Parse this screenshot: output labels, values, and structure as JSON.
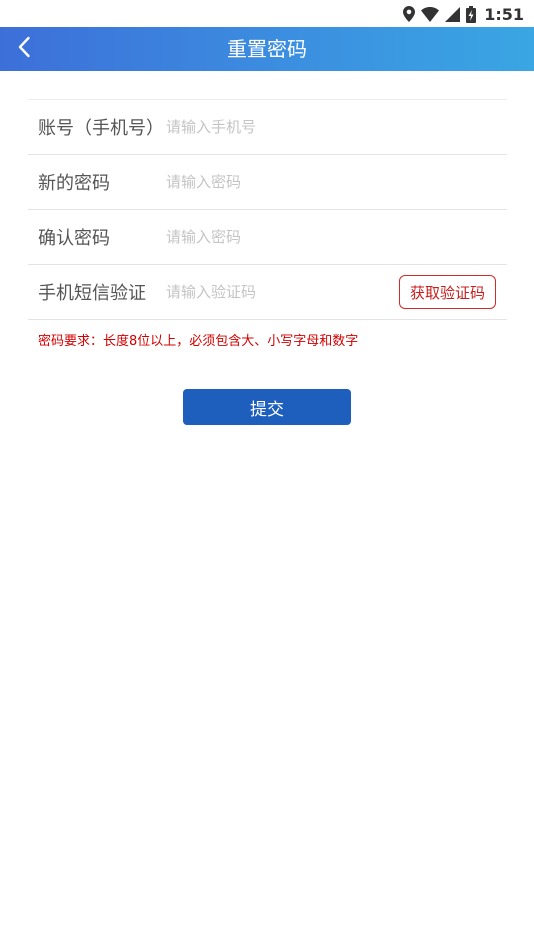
{
  "status_bar": {
    "time": "1:51",
    "icons": [
      "location-icon",
      "wifi-icon",
      "signal-icon",
      "battery-charging-icon"
    ]
  },
  "header": {
    "title": "重置密码",
    "back_icon": "chevron-left-icon"
  },
  "form": {
    "rows": [
      {
        "label": "账号（手机号）",
        "placeholder": "请输入手机号",
        "value": ""
      },
      {
        "label": "新的密码",
        "placeholder": "请输入密码",
        "value": ""
      },
      {
        "label": "确认密码",
        "placeholder": "请输入密码",
        "value": ""
      },
      {
        "label": "手机短信验证",
        "placeholder": "请输入验证码",
        "value": ""
      }
    ],
    "get_code_label": "获取验证码",
    "hint": "密码要求：长度8位以上，必须包含大、小写字母和数字",
    "submit_label": "提交"
  },
  "colors": {
    "header_start": "#3d6fd9",
    "header_end": "#3aa6e3",
    "submit": "#1e5fbd",
    "alert_red": "#d40000"
  }
}
